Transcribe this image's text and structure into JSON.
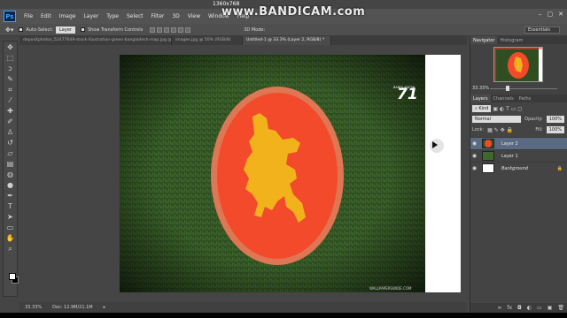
{
  "overlay": {
    "recorder_watermark": "www.BANDICAM.com",
    "resolution": "1360x768"
  },
  "menubar": {
    "logo": "Ps",
    "items": [
      "File",
      "Edit",
      "Image",
      "Layer",
      "Type",
      "Select",
      "Filter",
      "3D",
      "View",
      "Window",
      "Help"
    ],
    "window_controls": [
      "–",
      "▢",
      "✕"
    ]
  },
  "options_bar": {
    "auto_select_label": "Auto-Select:",
    "auto_select_target": "Layer",
    "show_transform_label": "Show Transform Controls",
    "mode_3d": "3D Mode:",
    "workspace": "Essentials"
  },
  "tabs": [
    {
      "label": "depositphotos_52477649-stock-illustration-green-bangladesh-map.jpg @ 50% (RGB/8)",
      "active": false
    },
    {
      "label": "images.jpg @ 50% (RGB/8)",
      "active": false
    },
    {
      "label": "Untitled-1 @ 33.3% (Layer 2, RGB/8) *",
      "active": true
    }
  ],
  "document": {
    "badge_number": "71",
    "badge_caption": "BANGLADESH",
    "footer_credit": "WALLPAPERSWIDE.COM"
  },
  "status_bar": {
    "zoom": "33.33%",
    "doc_info": "Doc: 12.9M/21.1M"
  },
  "navigator": {
    "tabs": [
      "Navigator",
      "Histogram"
    ],
    "zoom": "33.33%"
  },
  "layers_panel": {
    "tabs": [
      "Layers",
      "Channels",
      "Paths"
    ],
    "filter_kind": "Kind",
    "blend_mode": "Normal",
    "opacity_label": "Opacity:",
    "opacity_value": "100%",
    "lock_label": "Lock:",
    "fill_label": "Fill:",
    "fill_value": "100%",
    "layers": [
      {
        "name": "Layer 2",
        "selected": true
      },
      {
        "name": "Layer 1",
        "selected": false
      },
      {
        "name": "Background",
        "selected": false,
        "locked": true
      }
    ]
  },
  "colors": {
    "flag_red": "#f24a2a",
    "flag_map": "#f2b21c",
    "grass": "#2f4e22",
    "selection": "#5a6a83"
  }
}
